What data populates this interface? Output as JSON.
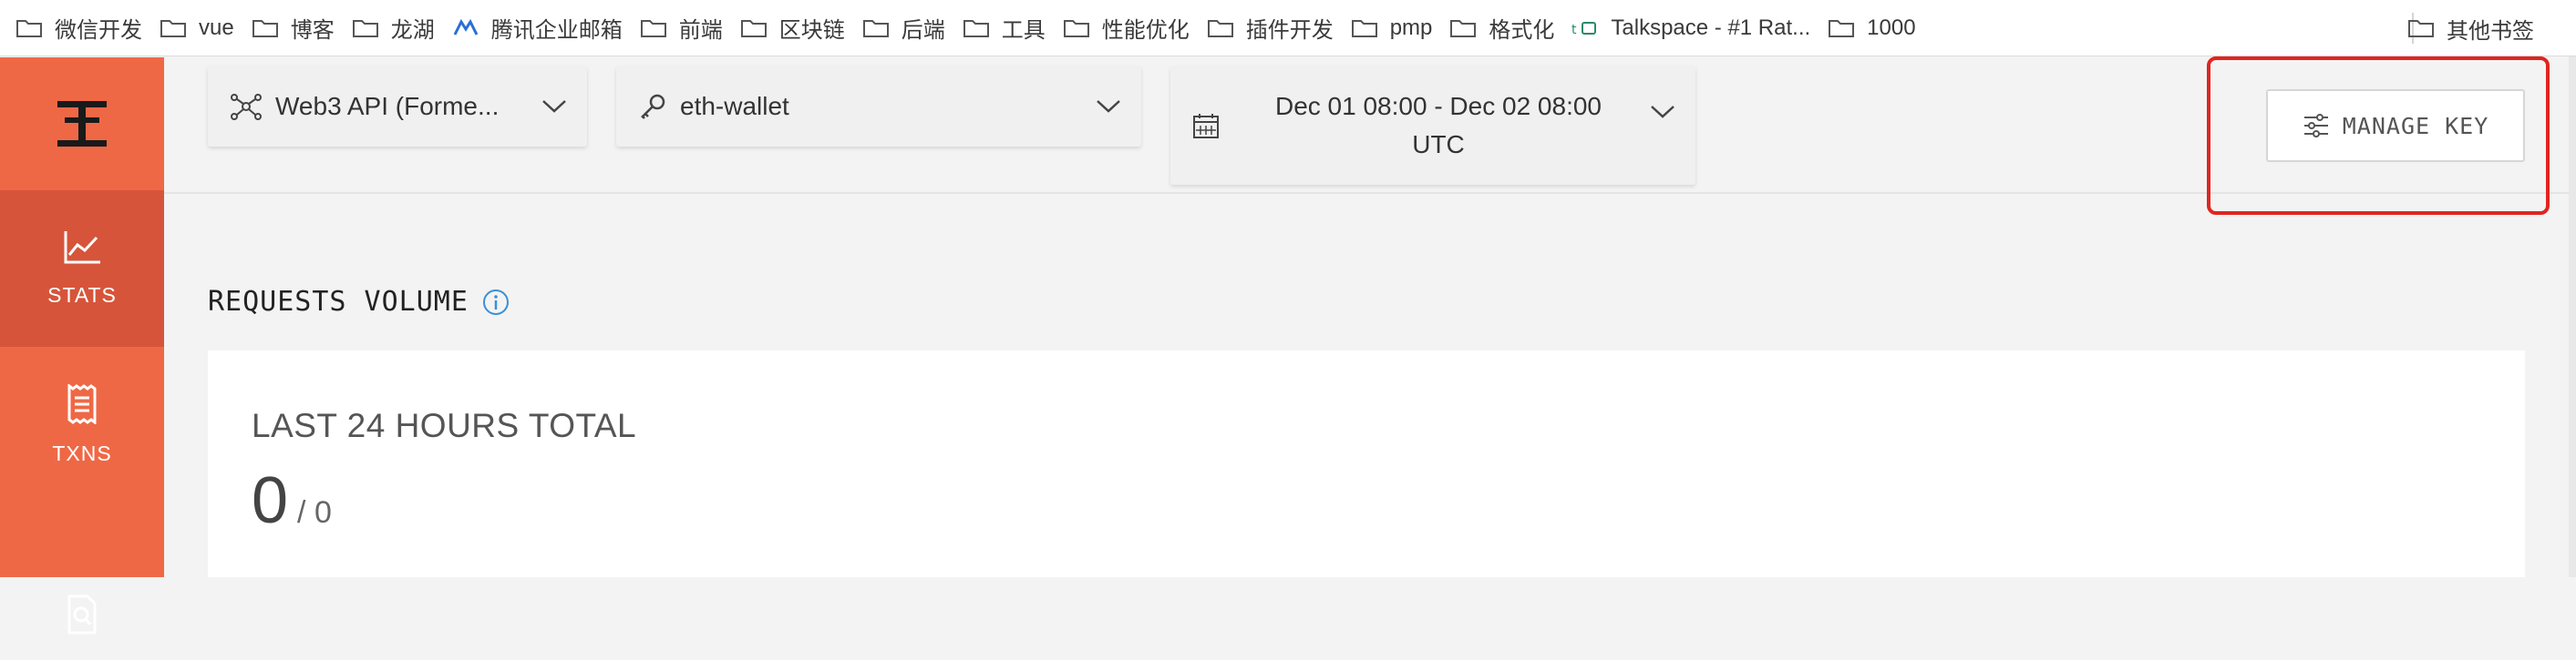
{
  "bookmarks": {
    "items": [
      {
        "label": "微信开发",
        "icon": "folder-icon"
      },
      {
        "label": "vue",
        "icon": "folder-icon"
      },
      {
        "label": "博客",
        "icon": "folder-icon"
      },
      {
        "label": "龙湖",
        "icon": "folder-icon"
      },
      {
        "label": "腾讯企业邮箱",
        "icon": "tencent-mail-icon"
      },
      {
        "label": "前端",
        "icon": "folder-icon"
      },
      {
        "label": "区块链",
        "icon": "folder-icon"
      },
      {
        "label": "后端",
        "icon": "folder-icon"
      },
      {
        "label": "工具",
        "icon": "folder-icon"
      },
      {
        "label": "性能优化",
        "icon": "folder-icon"
      },
      {
        "label": "插件开发",
        "icon": "folder-icon"
      },
      {
        "label": "pmp",
        "icon": "folder-icon"
      },
      {
        "label": "格式化",
        "icon": "folder-icon"
      },
      {
        "label": "Talkspace - #1 Rat...",
        "icon": "talkspace-icon"
      },
      {
        "label": "1000",
        "icon": "folder-icon"
      }
    ],
    "other": {
      "label": "其他书签",
      "icon": "folder-icon"
    }
  },
  "sidebar": {
    "logo": "app-logo",
    "items": [
      {
        "label": "STATS",
        "icon": "chart-icon",
        "active": true
      },
      {
        "label": "TXNS",
        "icon": "receipt-icon",
        "active": false
      },
      {
        "label": "",
        "icon": "search-document-icon",
        "active": false
      }
    ]
  },
  "header": {
    "network_selector": {
      "value": "Web3 API (Forme...",
      "icon": "network-icon"
    },
    "key_selector": {
      "value": "eth-wallet",
      "icon": "key-icon"
    },
    "date_range": {
      "line1": "Dec 01 08:00 - Dec 02 08:00",
      "line2": "UTC",
      "icon": "calendar-icon"
    },
    "manage_key": {
      "label": "MANAGE KEY",
      "icon": "sliders-icon"
    }
  },
  "main": {
    "section_title": "REQUESTS VOLUME",
    "card": {
      "title": "LAST 24 HOURS TOTAL",
      "value": "0",
      "total": "/ 0"
    }
  },
  "colors": {
    "sidebar": "#ef6845",
    "sidebar_active": "#d6553a",
    "highlight": "#e0251e",
    "info": "#3b8fd6"
  }
}
